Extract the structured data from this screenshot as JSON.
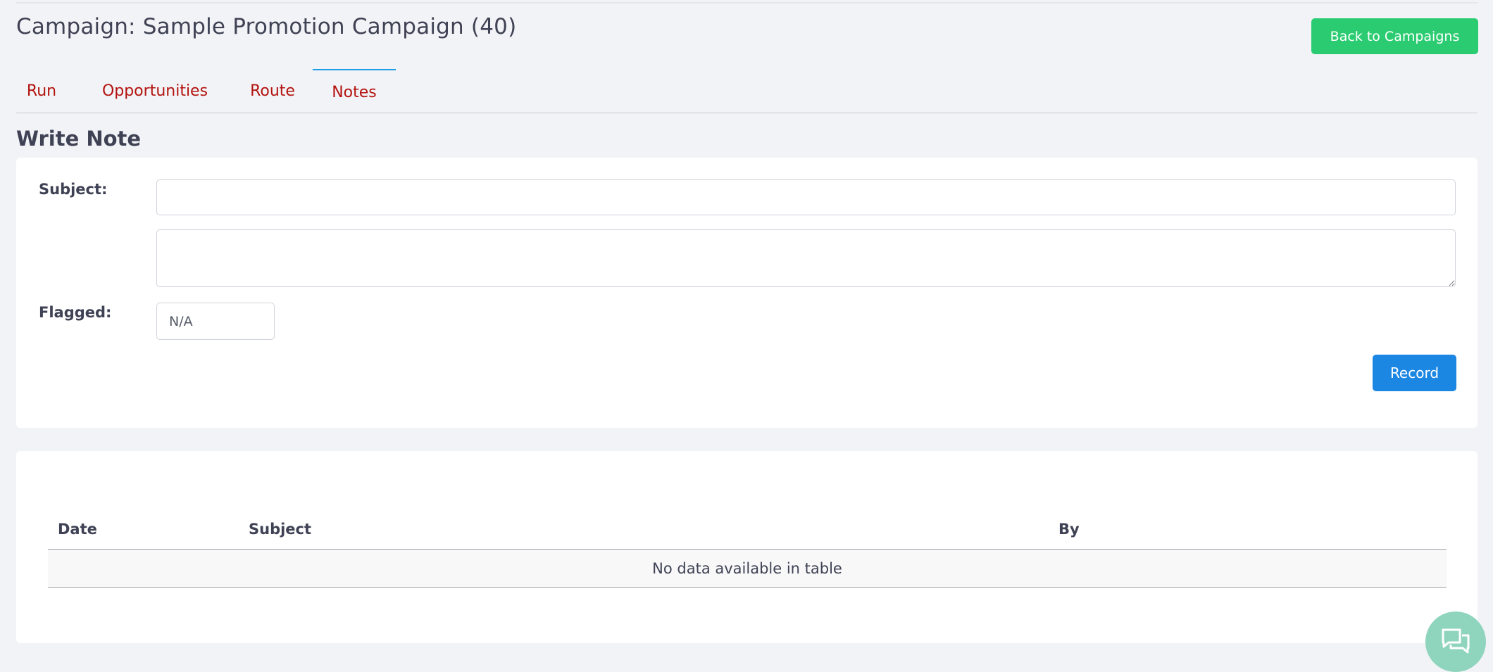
{
  "header": {
    "title": "Campaign: Sample Promotion Campaign (40)",
    "back_label": "Back to Campaigns"
  },
  "tabs": [
    {
      "label": "Run"
    },
    {
      "label": "Opportunities"
    },
    {
      "label": "Route"
    },
    {
      "label": "Notes",
      "active": true
    }
  ],
  "write_note": {
    "title": "Write Note",
    "subject_label": "Subject:",
    "subject_value": "",
    "body_value": "",
    "flagged_label": "Flagged:",
    "flagged_value": "N/A",
    "record_label": "Record"
  },
  "notes_table": {
    "columns": [
      "Date",
      "Subject",
      "By"
    ],
    "empty_message": "No data available in table"
  },
  "colors": {
    "accent_green": "#2bcc71",
    "primary_blue": "#1c86e3",
    "tab_text": "#b3130f",
    "tab_active_indicator": "#1f9ee6",
    "chat_bubble": "#8fd5bd"
  },
  "icons": {
    "chat": "chat-bubbles-icon"
  }
}
